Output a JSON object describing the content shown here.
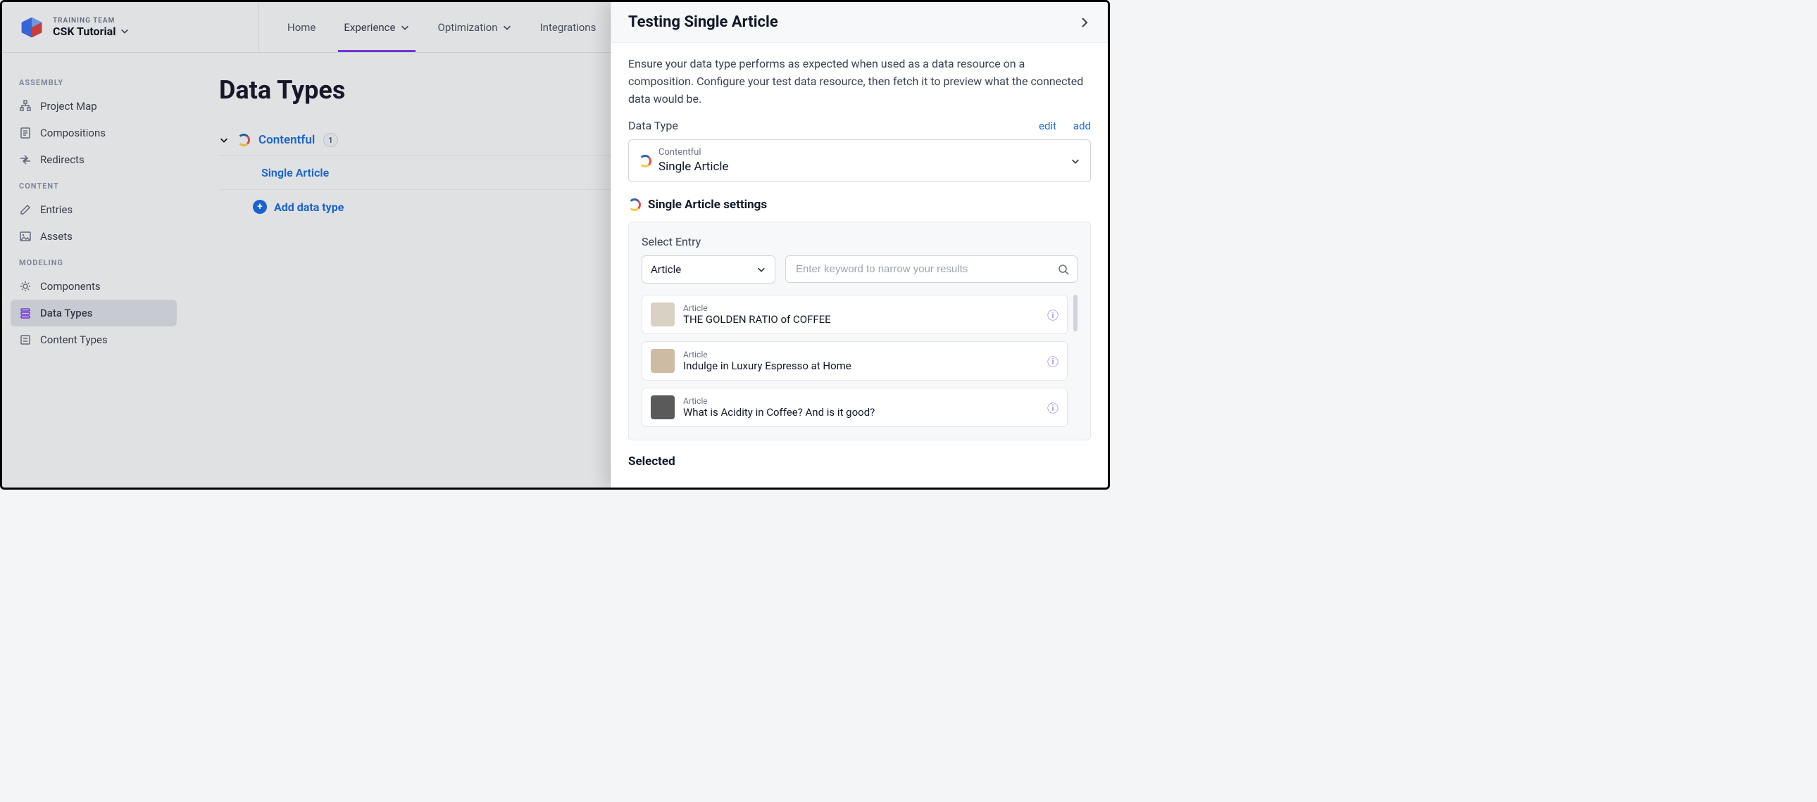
{
  "header": {
    "org": "TRAINING TEAM",
    "project": "CSK Tutorial",
    "nav": {
      "home": "Home",
      "experience": "Experience",
      "optimization": "Optimization",
      "integrations": "Integrations"
    }
  },
  "sidebar": {
    "groups": {
      "assembly": "ASSEMBLY",
      "content": "CONTENT",
      "modeling": "MODELING"
    },
    "items": {
      "project_map": "Project Map",
      "compositions": "Compositions",
      "redirects": "Redirects",
      "entries": "Entries",
      "assets": "Assets",
      "components": "Components",
      "data_types": "Data Types",
      "content_types": "Content Types"
    }
  },
  "main": {
    "title": "Data Types",
    "source": {
      "name": "Contentful",
      "count": "1"
    },
    "types": {
      "single_article": "Single Article"
    },
    "add_label": "Add data type"
  },
  "panel": {
    "title": "Testing Single Article",
    "description": "Ensure your data type performs as expected when used as a data resource on a composition. Configure your test data resource, then fetch it to preview what the connected data would be.",
    "data_type_label": "Data Type",
    "edit": "edit",
    "add": "add",
    "selector": {
      "source": "Contentful",
      "type": "Single Article"
    },
    "settings_title": "Single Article settings",
    "select_entry_label": "Select Entry",
    "content_type_dropdown": "Article",
    "search_placeholder": "Enter keyword to narrow your results",
    "entries": [
      {
        "kind": "Article",
        "title": "THE GOLDEN RATIO of COFFEE",
        "thumb": "#d9d1c4"
      },
      {
        "kind": "Article",
        "title": "Indulge in Luxury Espresso at Home",
        "thumb": "#cdbba3"
      },
      {
        "kind": "Article",
        "title": "What is Acidity in Coffee? And is it good?",
        "thumb": "#5a5a5a"
      }
    ],
    "selected_label": "Selected"
  }
}
